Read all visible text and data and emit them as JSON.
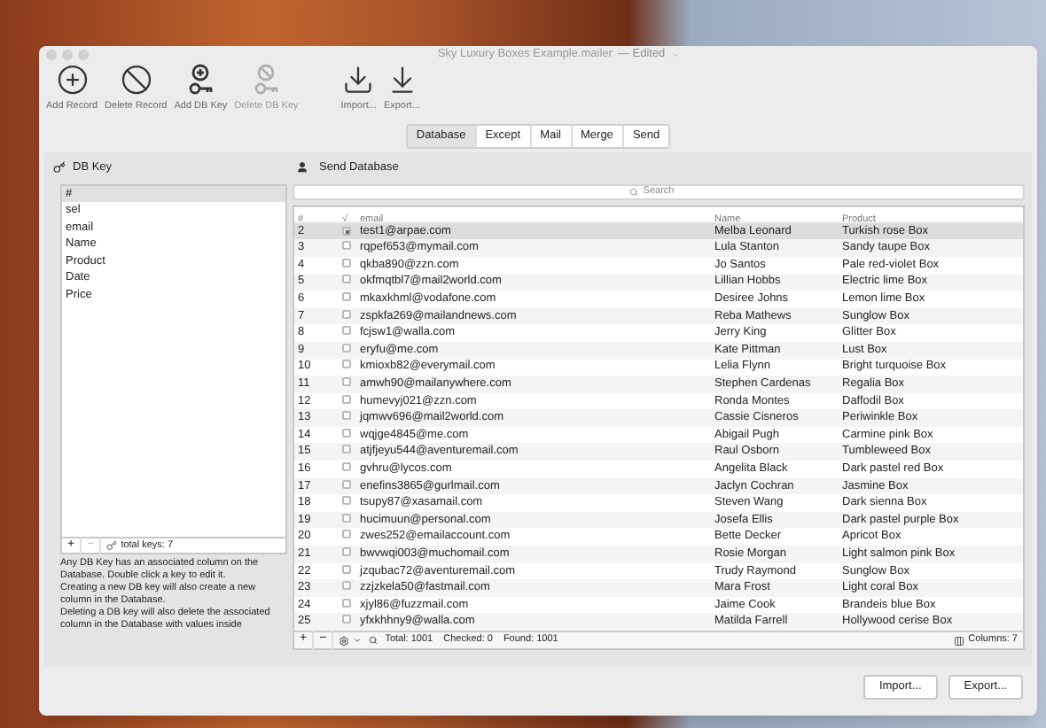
{
  "window": {
    "title": "Sky Luxury Boxes Example.mailer",
    "status": "— Edited"
  },
  "toolbar": {
    "left": [
      {
        "label": "Add Record",
        "disabled": false
      },
      {
        "label": "Delete Record",
        "disabled": false
      },
      {
        "label": "Add DB Key",
        "disabled": false
      },
      {
        "label": "Delete DB Key",
        "disabled": true
      }
    ],
    "right": [
      {
        "label": "Import...",
        "disabled": false
      },
      {
        "label": "Export...",
        "disabled": false
      }
    ]
  },
  "tabs": [
    {
      "label": "Database",
      "selected": true
    },
    {
      "label": "Except",
      "selected": false
    },
    {
      "label": "Mail",
      "selected": false
    },
    {
      "label": "Merge",
      "selected": false
    },
    {
      "label": "Send",
      "selected": false
    }
  ],
  "db_keys": {
    "title": "DB Key",
    "items": [
      {
        "label": "#",
        "selected": true
      },
      {
        "label": "sel",
        "selected": false
      },
      {
        "label": "email",
        "selected": false
      },
      {
        "label": "Name",
        "selected": false
      },
      {
        "label": "Product",
        "selected": false
      },
      {
        "label": "Date",
        "selected": false
      },
      {
        "label": "Price",
        "selected": false
      }
    ],
    "add": "+",
    "remove": "−",
    "total": "total keys: 7",
    "help": [
      "Any DB Key has an associated column on the Database. Double click a key to edit it.",
      "Creating a new DB key will also create a new column in the Database.",
      "Deleting a DB key will also delete the associated column in the Database with values inside"
    ]
  },
  "database": {
    "title": "Send Database",
    "search": {
      "placeholder": "Search"
    },
    "columns": [
      "#",
      "√",
      "email",
      "Name",
      "Product"
    ],
    "rows": [
      {
        "num": "2",
        "checked": true,
        "email": "test1@arpae.com",
        "name": "Melba Leonard",
        "product": "Turkish rose Box",
        "selected": true
      },
      {
        "num": "3",
        "checked": false,
        "email": "rqpef653@mymail.com",
        "name": "Lula Stanton",
        "product": "Sandy taupe Box",
        "selected": false
      },
      {
        "num": "4",
        "checked": false,
        "email": "qkba890@zzn.com",
        "name": "Jo Santos",
        "product": "Pale red-violet Box",
        "selected": false
      },
      {
        "num": "5",
        "checked": false,
        "email": "okfmqtbl7@mail2world.com",
        "name": "Lillian Hobbs",
        "product": "Electric lime Box",
        "selected": false
      },
      {
        "num": "6",
        "checked": false,
        "email": "mkaxkhml@vodafone.com",
        "name": "Desiree Johns",
        "product": "Lemon lime Box",
        "selected": false
      },
      {
        "num": "7",
        "checked": false,
        "email": "zspkfa269@mailandnews.com",
        "name": "Reba Mathews",
        "product": "Sunglow Box",
        "selected": false
      },
      {
        "num": "8",
        "checked": false,
        "email": "fcjsw1@walla.com",
        "name": "Jerry King",
        "product": "Glitter Box",
        "selected": false
      },
      {
        "num": "9",
        "checked": false,
        "email": "eryfu@me.com",
        "name": "Kate Pittman",
        "product": "Lust Box",
        "selected": false
      },
      {
        "num": "10",
        "checked": false,
        "email": "kmioxb82@everymail.com",
        "name": "Lelia Flynn",
        "product": "Bright turquoise Box",
        "selected": false
      },
      {
        "num": "11",
        "checked": false,
        "email": "amwh90@mailanywhere.com",
        "name": "Stephen Cardenas",
        "product": "Regalia Box",
        "selected": false
      },
      {
        "num": "12",
        "checked": false,
        "email": "humevyj021@zzn.com",
        "name": "Ronda Montes",
        "product": "Daffodil Box",
        "selected": false
      },
      {
        "num": "13",
        "checked": false,
        "email": "jqmwv696@mail2world.com",
        "name": "Cassie Cisneros",
        "product": "Periwinkle Box",
        "selected": false
      },
      {
        "num": "14",
        "checked": false,
        "email": "wqjge4845@me.com",
        "name": "Abigail Pugh",
        "product": "Carmine pink Box",
        "selected": false
      },
      {
        "num": "15",
        "checked": false,
        "email": "atjfjeyu544@aventuremail.com",
        "name": "Raul Osborn",
        "product": "Tumbleweed Box",
        "selected": false
      },
      {
        "num": "16",
        "checked": false,
        "email": "gvhru@lycos.com",
        "name": "Angelita Black",
        "product": "Dark pastel red Box",
        "selected": false
      },
      {
        "num": "17",
        "checked": false,
        "email": "enefins3865@gurlmail.com",
        "name": "Jaclyn Cochran",
        "product": "Jasmine Box",
        "selected": false
      },
      {
        "num": "18",
        "checked": false,
        "email": "tsupy87@xasamail.com",
        "name": "Steven Wang",
        "product": "Dark sienna Box",
        "selected": false
      },
      {
        "num": "19",
        "checked": false,
        "email": "hucimuun@personal.com",
        "name": "Josefa Ellis",
        "product": "Dark pastel purple Box",
        "selected": false
      },
      {
        "num": "20",
        "checked": false,
        "email": "zwes252@emailaccount.com",
        "name": "Bette Decker",
        "product": "Apricot Box",
        "selected": false
      },
      {
        "num": "21",
        "checked": false,
        "email": "bwvwqi003@muchomail.com",
        "name": "Rosie Morgan",
        "product": "Light salmon pink Box",
        "selected": false
      },
      {
        "num": "22",
        "checked": false,
        "email": "jzqubac72@aventuremail.com",
        "name": "Trudy Raymond",
        "product": "Sunglow Box",
        "selected": false
      },
      {
        "num": "23",
        "checked": false,
        "email": "zzjzkela50@fastmail.com",
        "name": "Mara Frost",
        "product": "Light coral Box",
        "selected": false
      },
      {
        "num": "24",
        "checked": false,
        "email": "xjyl86@fuzzmail.com",
        "name": "Jaime Cook",
        "product": "Brandeis blue Box",
        "selected": false
      },
      {
        "num": "25",
        "checked": false,
        "email": "yfxkhhny9@walla.com",
        "name": "Matilda Farrell",
        "product": "Hollywood cerise Box",
        "selected": false
      }
    ],
    "footer": {
      "add": "+",
      "remove": "−",
      "total": "Total: 1001",
      "checked": "Checked: 0",
      "found": "Found: 1001",
      "columns": "Columns: 7"
    }
  },
  "buttons": [
    "Import...",
    "Export..."
  ]
}
